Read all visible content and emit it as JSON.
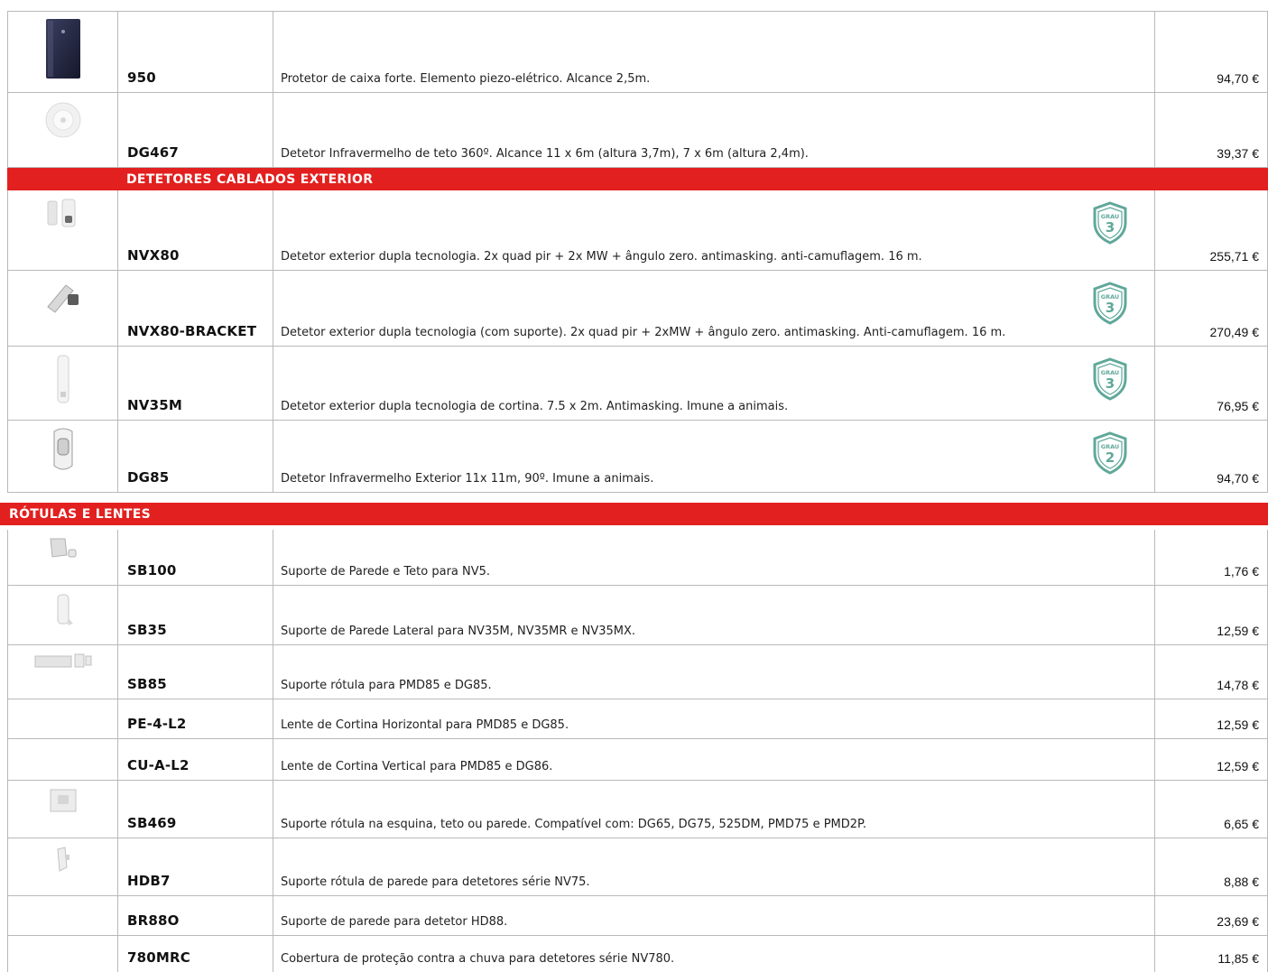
{
  "catalog": {
    "products_top": [
      {
        "code": "950",
        "description": "Protetor de caixa forte. Elemento piezo-elétrico. Alcance 2,5m.",
        "price": "94,70 €",
        "image": "dark-box-sensor-image"
      },
      {
        "code": "DG467",
        "description": "Detetor Infravermelho de teto 360º. Alcance 11 x 6m (altura 3,7m), 7 x 6m (altura 2,4m).",
        "price": "39,37 €",
        "image": "ceiling-detector-image"
      }
    ],
    "section_exterior": {
      "title": "DETETORES CABLADOS EXTERIOR",
      "items": [
        {
          "code": "NVX80",
          "description": "Detetor exterior dupla tecnologia. 2x quad pir + 2x MW + ângulo zero. antimasking. anti-camuflagem. 16 m.",
          "price": "255,71 €",
          "badge": {
            "label": "GRAU",
            "grade": "3"
          }
        },
        {
          "code": "NVX80-BRACKET",
          "description": "Detetor exterior dupla tecnologia (com suporte). 2x quad pir + 2xMW + ângulo zero. antimasking. Anti-camuflagem. 16 m.",
          "price": "270,49 €",
          "badge": {
            "label": "GRAU",
            "grade": "3"
          }
        },
        {
          "code": "NV35M",
          "description": "Detetor exterior dupla tecnologia de cortina. 7.5 x 2m. Antimasking. Imune a animais.",
          "price": "76,95 €",
          "badge": {
            "label": "GRAU",
            "grade": "3"
          }
        },
        {
          "code": "DG85",
          "description": "Detetor Infravermelho Exterior  11x 11m, 90º. Imune a animais.",
          "price": "94,70 €",
          "badge": {
            "label": "GRAU",
            "grade": "2"
          }
        }
      ]
    },
    "section_brackets": {
      "title": "RÓTULAS E LENTES",
      "items": [
        {
          "code": "SB100",
          "description": "Suporte de Parede e Teto para NV5.",
          "price": "1,76 €"
        },
        {
          "code": "SB35",
          "description": "Suporte de Parede Lateral para NV35M, NV35MR e NV35MX.",
          "price": "12,59 €"
        },
        {
          "code": "SB85",
          "description": "Suporte rótula para PMD85 e DG85.",
          "price": "14,78 €"
        },
        {
          "code": "PE-4-L2",
          "description": "Lente de Cortina Horizontal para PMD85 e DG85.",
          "price": "12,59 €"
        },
        {
          "code": "CU-A-L2",
          "description": "Lente de Cortina Vertical para PMD85 e DG86.",
          "price": "12,59 €"
        },
        {
          "code": "SB469",
          "description": "Suporte rótula na esquina, teto ou parede. Compatível com: DG65, DG75, 525DM, PMD75 e PMD2P.",
          "price": "6,65 €"
        },
        {
          "code": "HDB7",
          "description": "Suporte rótula de parede para detetores série NV75.",
          "price": "8,88 €"
        },
        {
          "code": "BR88O",
          "description": "Suporte de parede para detetor HD88.",
          "price": "23,69 €"
        },
        {
          "code": "780MRC",
          "description": "Cobertura de proteção contra a chuva para detetores série NV780.",
          "price": "11,85 €"
        }
      ]
    },
    "colors": {
      "section_red": "#e2201f",
      "badge_teal": "#5fa89a",
      "grid": "#b9b9b9"
    }
  }
}
